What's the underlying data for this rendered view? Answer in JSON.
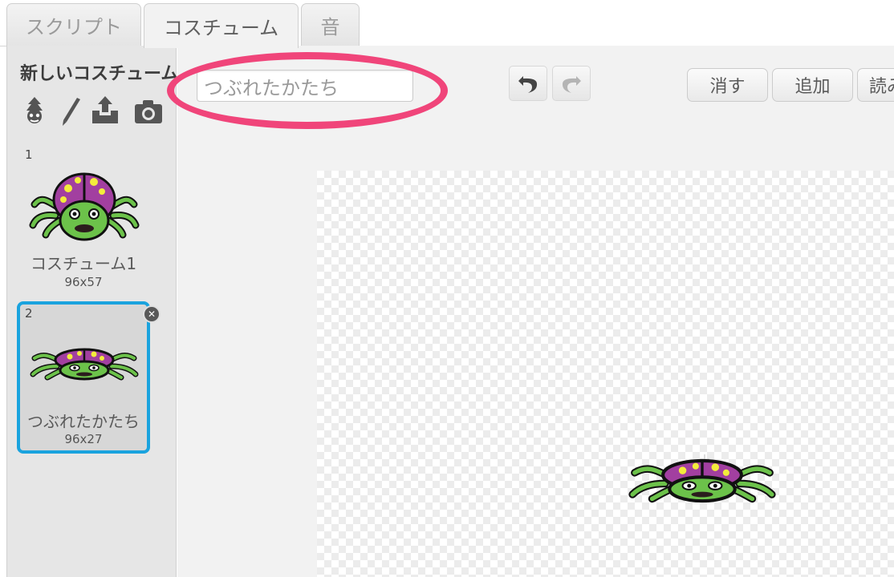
{
  "tabs": [
    {
      "label": "スクリプト",
      "active": false
    },
    {
      "label": "コスチューム",
      "active": true
    },
    {
      "label": "音",
      "active": false
    }
  ],
  "sidebar": {
    "new_costume_label": "新しいコスチューム",
    "tools": [
      {
        "icon": "sprite-library-icon"
      },
      {
        "icon": "paint-brush-icon"
      },
      {
        "icon": "upload-icon"
      },
      {
        "icon": "camera-icon"
      }
    ],
    "costumes": [
      {
        "index": "1",
        "name": "コスチューム1",
        "size": "96x57",
        "selected": false
      },
      {
        "index": "2",
        "name": "つぶれたかたち",
        "size": "96x27",
        "selected": true
      }
    ]
  },
  "editor": {
    "costume_name_value": "つぶれたかたち",
    "undo_icon": "undo-icon",
    "redo_icon": "redo-icon",
    "buttons": {
      "clear": "消す",
      "add": "追加",
      "import": "読み"
    }
  },
  "colors": {
    "highlight": "#f0457a",
    "selection": "#1aa3de"
  }
}
